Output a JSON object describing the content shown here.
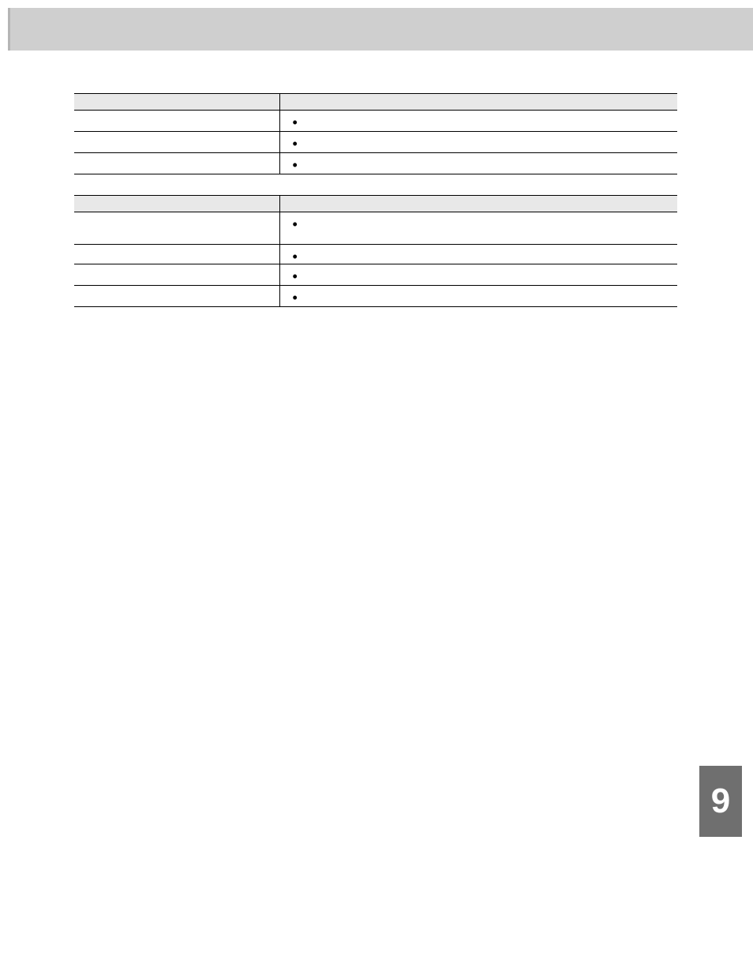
{
  "sideTab": "9",
  "section1": {
    "title": "",
    "header1": "",
    "header2": "",
    "rows": [
      {
        "c1": "",
        "c2": ""
      },
      {
        "c1": "",
        "c2": ""
      },
      {
        "c1": "",
        "c2": ""
      }
    ]
  },
  "section2": {
    "title": "",
    "header1": "",
    "header2": "",
    "rows": [
      {
        "c1": "",
        "c2a": "",
        "c2b": ""
      },
      {
        "c1": "",
        "c2": ""
      },
      {
        "c1": "",
        "c2": ""
      },
      {
        "c1": "",
        "c2": ""
      }
    ]
  }
}
